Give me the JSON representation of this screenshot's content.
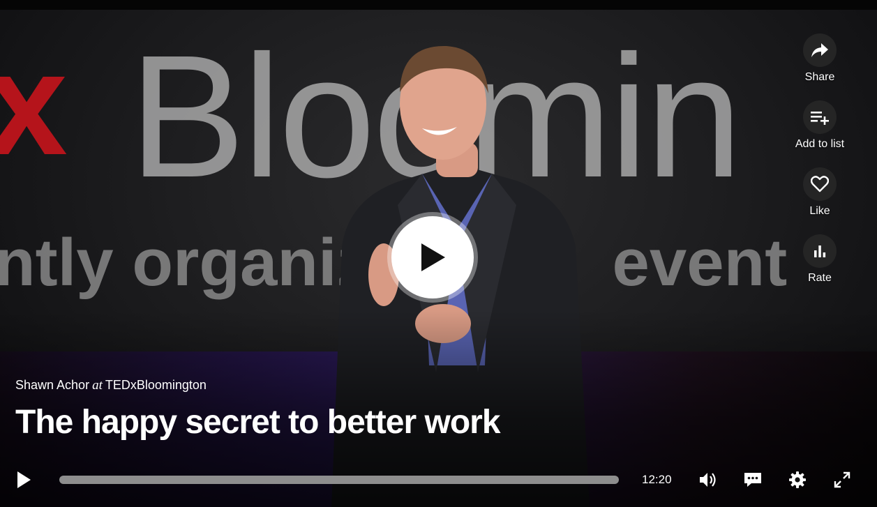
{
  "video": {
    "backdrop": {
      "brand": "x",
      "word": "Bloomin",
      "subline": "ntly organize           event"
    }
  },
  "side_actions": [
    {
      "label": "Share",
      "icon": "share-icon"
    },
    {
      "label": "Add to list",
      "icon": "add-to-list-icon"
    },
    {
      "label": "Like",
      "icon": "heart-icon"
    },
    {
      "label": "Rate",
      "icon": "bar-chart-icon"
    }
  ],
  "talk": {
    "speaker": "Shawn Achor",
    "at": "at",
    "event": "TEDxBloomington",
    "title": "The happy secret to better work"
  },
  "player": {
    "duration": "12:20",
    "progress_fraction": 0.0,
    "accent_color": "#e62b1e",
    "controls": [
      "play-icon",
      "volume-icon",
      "subtitles-icon",
      "settings-icon",
      "fullscreen-icon"
    ]
  }
}
